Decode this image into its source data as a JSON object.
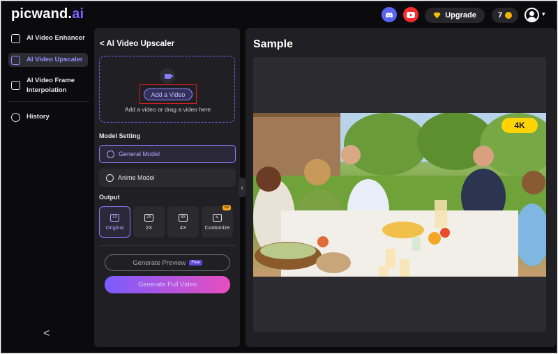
{
  "header": {
    "logo_main": "picwand",
    "logo_dot": ".",
    "logo_ai": "ai",
    "upgrade_label": "Upgrade",
    "credits": "7"
  },
  "sidebar": {
    "items": [
      {
        "label": "AI Video Enhancer",
        "icon": "enhancer-icon"
      },
      {
        "label": "AI Video Upscaler",
        "icon": "upscaler-icon",
        "active": true
      },
      {
        "label": "AI Video Frame Interpolation",
        "icon": "interpolation-icon"
      },
      {
        "label": "History",
        "icon": "history-icon"
      }
    ],
    "collapse": "<"
  },
  "panel": {
    "title": "AI Video Upscaler",
    "back_icon": "<",
    "add_video_label": "Add a Video",
    "drop_text": "Add a video or drag a video here",
    "model_setting_label": "Model Setting",
    "models": [
      {
        "label": "General Model",
        "selected": true
      },
      {
        "label": "Anime Model",
        "selected": false
      }
    ],
    "output_label": "Output",
    "outputs": [
      {
        "icon": "1X",
        "label": "Original",
        "selected": true
      },
      {
        "icon": "2X",
        "label": "2X",
        "selected": false
      },
      {
        "icon": "4X",
        "label": "4X",
        "selected": false
      },
      {
        "icon": "✎",
        "label": "Customize",
        "selected": false,
        "vip": "VIP"
      }
    ],
    "generate_preview": "Generate Preview",
    "free_badge": "Free",
    "generate_full": "Generate Full Video"
  },
  "sample": {
    "title": "Sample",
    "badge": "4K"
  },
  "colors": {
    "accent": "#7b61ff",
    "background": "#0b0b0e",
    "panel": "#202024",
    "highlight": "#d11f1f",
    "badge": "#ffd400"
  }
}
